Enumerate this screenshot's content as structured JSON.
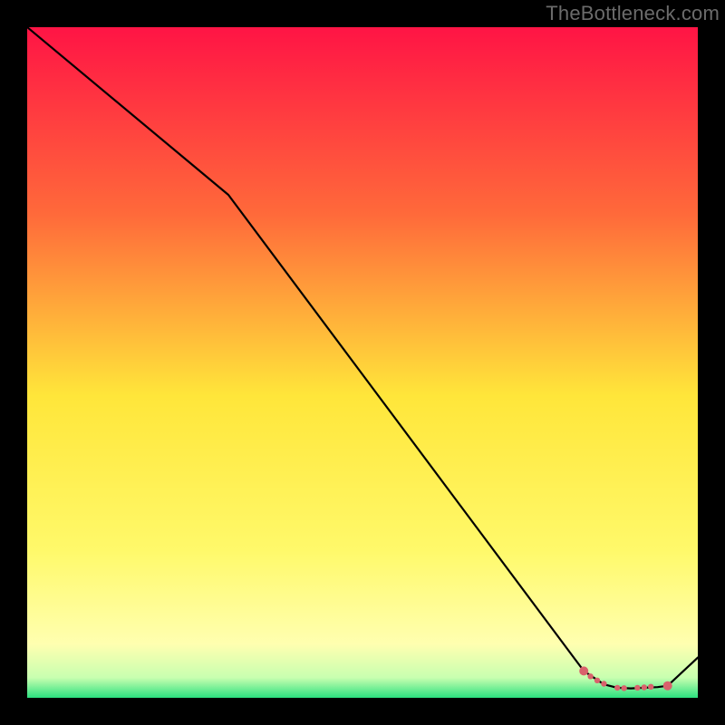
{
  "watermark": "TheBottleneck.com",
  "colors": {
    "border": "#000000",
    "line": "#000000",
    "marker": "#d9626c",
    "gradient_top": "#ff1445",
    "gradient_mid_upper": "#ff8a3a",
    "gradient_mid": "#ffe63a",
    "gradient_lower": "#ffffb0",
    "gradient_bottom": "#2be07f"
  },
  "chart_data": {
    "type": "line",
    "title": "",
    "xlabel": "",
    "ylabel": "",
    "xlim": [
      0,
      100
    ],
    "ylim": [
      0,
      100
    ],
    "grid": false,
    "legend": false,
    "series": [
      {
        "name": "curve",
        "x": [
          0,
          30,
          83,
          86,
          88,
          90,
          92,
          94,
          95.5,
          100
        ],
        "y": [
          100,
          75,
          4,
          2,
          1.5,
          1.4,
          1.5,
          1.6,
          1.8,
          6
        ]
      }
    ],
    "markers": {
      "name": "highlight-points",
      "x": [
        83,
        84,
        85,
        86,
        88,
        89,
        91,
        92,
        93,
        95.5
      ],
      "y": [
        4,
        3.2,
        2.6,
        2.1,
        1.5,
        1.45,
        1.5,
        1.55,
        1.65,
        1.8
      ]
    }
  }
}
